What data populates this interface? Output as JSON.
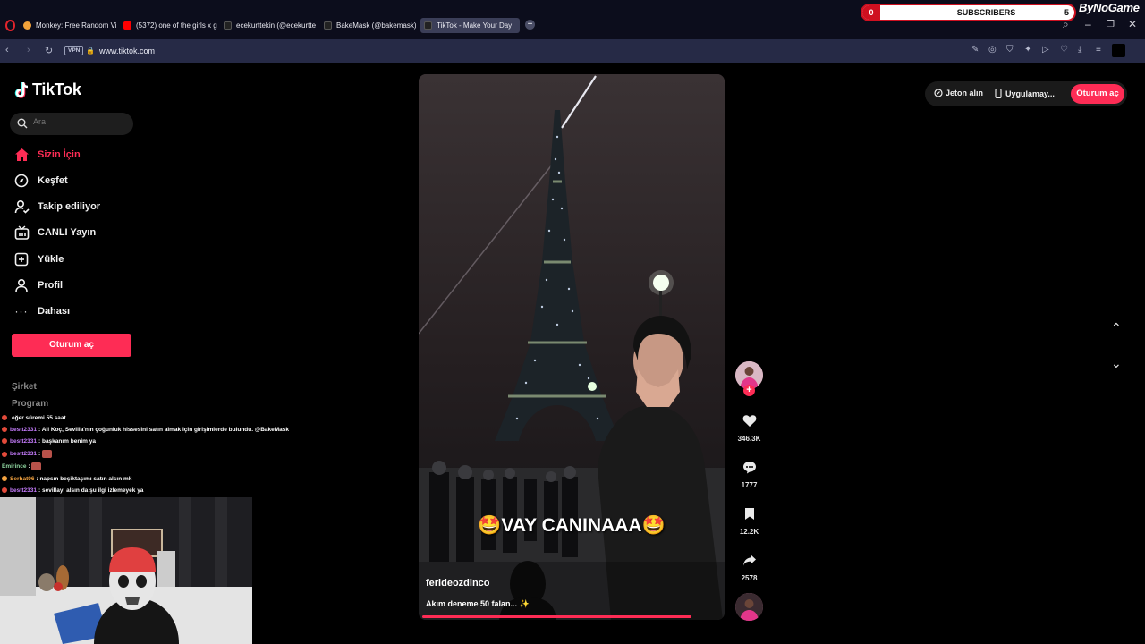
{
  "browser": {
    "tabs": [
      {
        "label": "Monkey: Free Random Vi",
        "color": "#f2a23a"
      },
      {
        "label": "(5372) one of the girls x g",
        "color": "#ff0000"
      },
      {
        "label": "ecekurttekin (@ecekurtte",
        "color": "#222222"
      },
      {
        "label": "BakeMask (@bakemask) |",
        "color": "#222222"
      },
      {
        "label": "TikTok - Make Your Day",
        "color": "#222222"
      }
    ],
    "new_tab": "+",
    "address": {
      "vpn": "VPN",
      "url": "www.tiktok.com"
    }
  },
  "overlay": {
    "subscribers_label": "SUBSCRIBERS",
    "subscribers_current": "0",
    "subscribers_goal": "5",
    "brand": "ByNoGame"
  },
  "tiktok": {
    "logo_text": "TikTok",
    "search_placeholder": "Ara",
    "nav": [
      {
        "label": "Sizin İçin",
        "icon": "home-icon"
      },
      {
        "label": "Keşfet",
        "icon": "compass-icon"
      },
      {
        "label": "Takip ediliyor",
        "icon": "following-icon"
      },
      {
        "label": "CANLI Yayın",
        "icon": "live-icon"
      },
      {
        "label": "Yükle",
        "icon": "upload-icon"
      },
      {
        "label": "Profil",
        "icon": "profile-icon"
      },
      {
        "label": "Dahası",
        "icon": "more-icon"
      }
    ],
    "login_button": "Oturum aç",
    "footer": [
      "Şirket",
      "Program"
    ],
    "topbar": {
      "coins": "Jeton alın",
      "app": "Uygulamay...",
      "login": "Oturum aç"
    },
    "video": {
      "overlay_caption": "🤩VAY CANINAAA🤩",
      "author": "ferideozdinco",
      "description": "Akım deneme 50 falan... ✨",
      "progress": 0.9
    },
    "actions": {
      "likes": "346.3K",
      "comments": "1777",
      "saves": "12.2K",
      "shares": "2578"
    }
  },
  "chat": [
    {
      "user": "",
      "text": "eğer süremi 55 saat",
      "color": "#c77dff"
    },
    {
      "user": "bestt2331",
      "text": ": Ali Koç, Sevilla'nın çoğunluk hissesini satın almak için girişimlerde bulundu. @BakeMask",
      "color": "#c77dff"
    },
    {
      "user": "bestt2331",
      "text": ": başkanım benim ya",
      "color": "#c77dff"
    },
    {
      "user": "bestt2331",
      "text": ":",
      "color": "#c77dff"
    },
    {
      "user": "Emirince",
      "text": ":",
      "color": "#8fd6a0"
    },
    {
      "user": "Serhat06",
      "text": ": napsın beşiktaşımı satın alsın mk",
      "color": "#f4a340"
    },
    {
      "user": "bestt2331",
      "text": ": sevillayı alsın da şu ilgi izlemeyek ya",
      "color": "#c77dff"
    }
  ]
}
